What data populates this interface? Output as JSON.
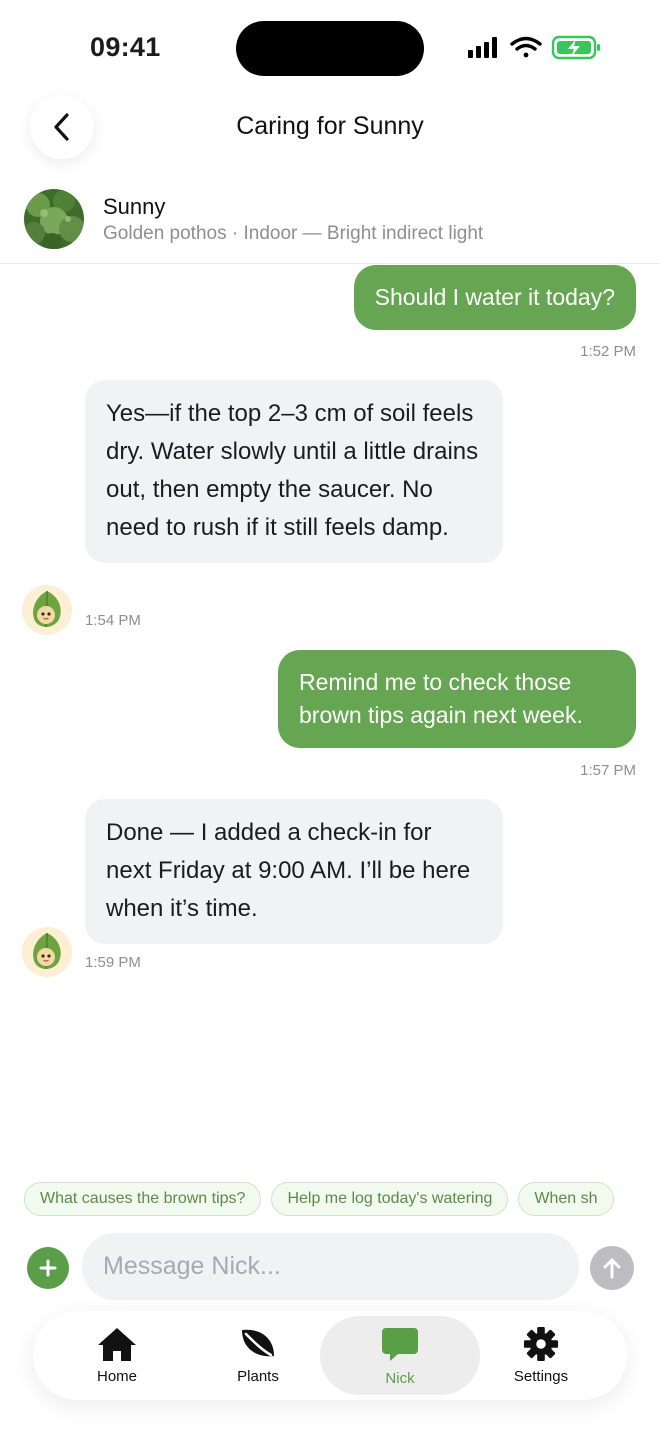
{
  "status_bar": {
    "time": "09:41"
  },
  "header": {
    "title": "Caring for Sunny"
  },
  "plant": {
    "name": "Sunny",
    "meta": "Golden pothos · Indoor — Bright indirect light"
  },
  "messages": [
    {
      "from": "user",
      "text": "Should I water it today?",
      "time": "1:52 PM"
    },
    {
      "from": "assistant",
      "text": "Yes—if the top 2–3 cm of soil feels dry. Water slowly until a little drains out, then empty the saucer. No need to rush if it still feels damp.",
      "time": "1:54 PM"
    },
    {
      "from": "user",
      "text": "Remind me to check those brown tips again next week.",
      "time": "1:57 PM"
    },
    {
      "from": "assistant",
      "text": "Done — I added a check-in for next Friday at 9:00 AM. I’ll be here when it’s time.",
      "time": "1:59 PM"
    }
  ],
  "suggestions": [
    "What causes the brown tips?",
    "Help me log today's watering",
    "When sh"
  ],
  "composer": {
    "placeholder": "Message Nick..."
  },
  "tabs": [
    {
      "label": "Home",
      "icon": "house-icon"
    },
    {
      "label": "Plants",
      "icon": "leaf-icon"
    },
    {
      "label": "Nick",
      "icon": "chat-bubble-icon",
      "active": true
    },
    {
      "label": "Settings",
      "icon": "gear-icon"
    }
  ],
  "colors": {
    "accent": "#66a552",
    "bubble_bot": "#f1f2f4",
    "chip_text": "#5c8b4a"
  }
}
